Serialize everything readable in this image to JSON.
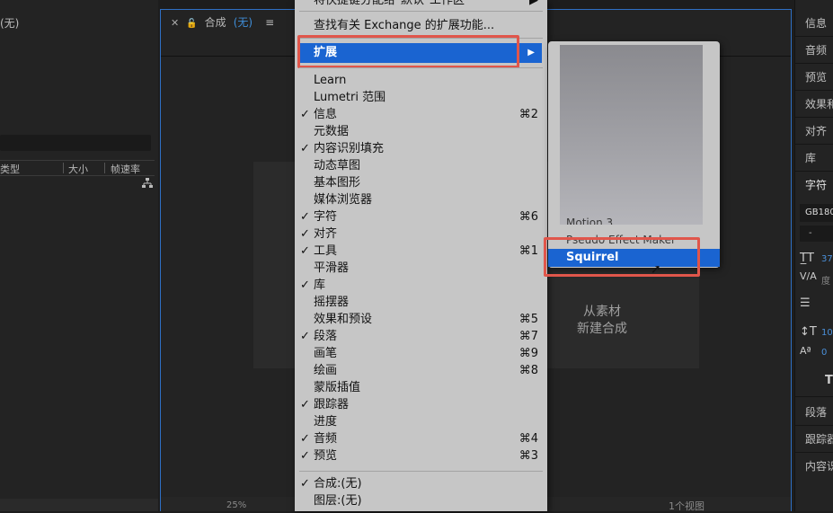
{
  "project_panel": {
    "title": "(无)",
    "columns": [
      "类型",
      "大小",
      "帧速率"
    ]
  },
  "composition_panel": {
    "tab_label": "合成",
    "tab_value": "(无)",
    "new_comp_line1": "从素材",
    "new_comp_line2": "新建合成",
    "zoom": "25%",
    "views": "1个视图"
  },
  "right_panel": {
    "items_top": [
      "信息",
      "音频",
      "预览",
      "效果和",
      "对齐",
      "库",
      "字符"
    ],
    "font_name": "GB180",
    "font_style": "-",
    "font_size": "37",
    "tracking_label": "度",
    "leading_value": "10",
    "baseline_value": "0",
    "items_bottom": [
      "段落",
      "跟踪器",
      "内容识"
    ]
  },
  "window_menu": {
    "top_partial": "将快捷键分配给\"默认\"工作区",
    "find_extensions": "查找有关 Exchange 的扩展功能...",
    "extensions": "扩展",
    "items": [
      {
        "label": "Learn",
        "checked": false,
        "shortcut": ""
      },
      {
        "label": "Lumetri 范围",
        "checked": false,
        "shortcut": ""
      },
      {
        "label": "信息",
        "checked": true,
        "shortcut": "⌘2"
      },
      {
        "label": "元数据",
        "checked": false,
        "shortcut": ""
      },
      {
        "label": "内容识别填充",
        "checked": true,
        "shortcut": ""
      },
      {
        "label": "动态草图",
        "checked": false,
        "shortcut": ""
      },
      {
        "label": "基本图形",
        "checked": false,
        "shortcut": ""
      },
      {
        "label": "媒体浏览器",
        "checked": false,
        "shortcut": ""
      },
      {
        "label": "字符",
        "checked": true,
        "shortcut": "⌘6"
      },
      {
        "label": "对齐",
        "checked": true,
        "shortcut": ""
      },
      {
        "label": "工具",
        "checked": true,
        "shortcut": "⌘1"
      },
      {
        "label": "平滑器",
        "checked": false,
        "shortcut": ""
      },
      {
        "label": "库",
        "checked": true,
        "shortcut": ""
      },
      {
        "label": "摇摆器",
        "checked": false,
        "shortcut": ""
      },
      {
        "label": "效果和预设",
        "checked": false,
        "shortcut": "⌘5"
      },
      {
        "label": "段落",
        "checked": true,
        "shortcut": "⌘7"
      },
      {
        "label": "画笔",
        "checked": false,
        "shortcut": "⌘9"
      },
      {
        "label": "绘画",
        "checked": false,
        "shortcut": "⌘8"
      },
      {
        "label": "蒙版插值",
        "checked": false,
        "shortcut": ""
      },
      {
        "label": "跟踪器",
        "checked": true,
        "shortcut": ""
      },
      {
        "label": "进度",
        "checked": false,
        "shortcut": ""
      },
      {
        "label": "音频",
        "checked": true,
        "shortcut": "⌘4"
      },
      {
        "label": "预览",
        "checked": true,
        "shortcut": "⌘3"
      }
    ],
    "bottom_items": [
      {
        "label": "合成:(无)",
        "checked": true
      },
      {
        "label": "图层:(无)",
        "checked": false
      }
    ]
  },
  "extensions_submenu": {
    "partial_1": "Motion 3",
    "partial_2": "Pseudo Effect Maker",
    "selected": "Squirrel"
  },
  "colors": {
    "highlight": "#1a64d1",
    "callout": "#e0564b",
    "menu_bg": "#c6c6c6",
    "panel_border": "#2e6fc4"
  }
}
